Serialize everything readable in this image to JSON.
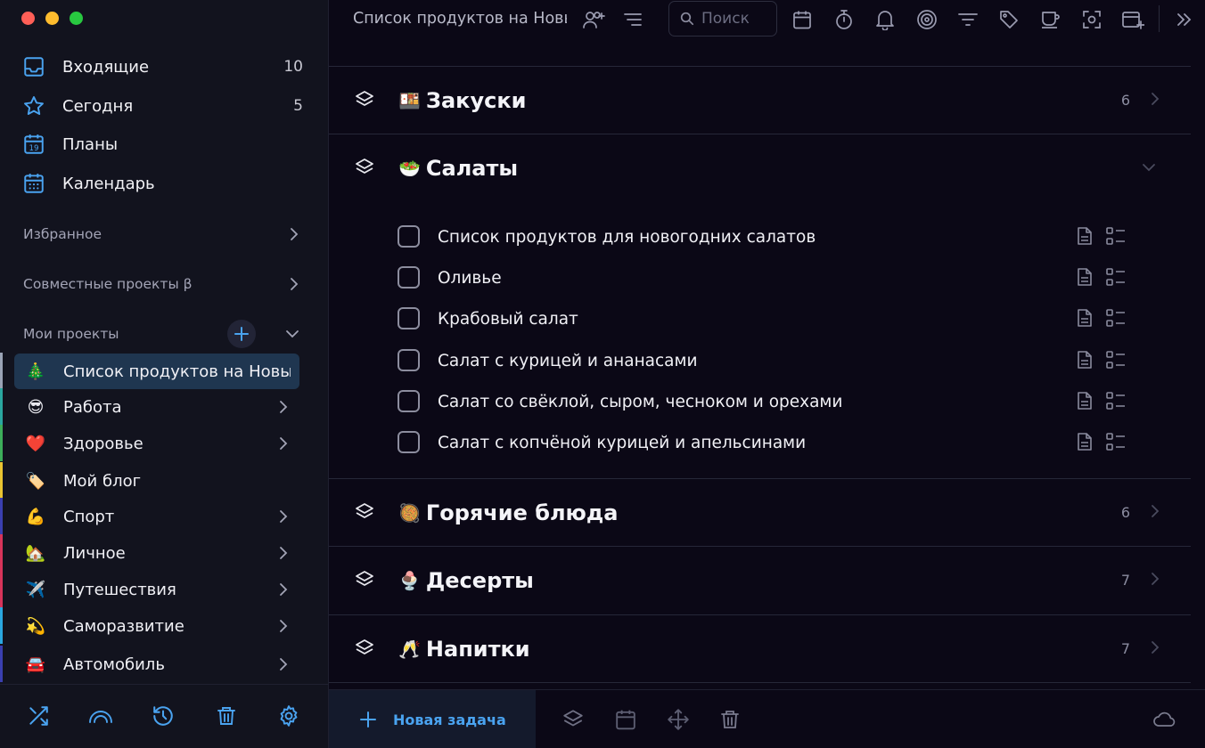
{
  "colors": {
    "accent": "#4aa3f0",
    "active_project_bg": "#1f3650"
  },
  "nav": {
    "inbox": {
      "label": "Входящие",
      "count": "10",
      "icon": "inbox-icon"
    },
    "today": {
      "label": "Сегодня",
      "count": "5",
      "icon": "star-icon"
    },
    "plans": {
      "label": "Планы",
      "icon": "calendar-19-icon"
    },
    "calendar": {
      "label": "Календарь",
      "icon": "calendar-grid-icon"
    }
  },
  "sections": {
    "favorites": "Избранное",
    "shared": "Совместные проекты β",
    "my_projects": "Мои проекты"
  },
  "projects": [
    {
      "emoji": "🎄",
      "label": "Список продуктов на Новый год",
      "color": "#9aa3b5"
    },
    {
      "emoji": "😎",
      "label": "Работа",
      "color": "#2aa7a0"
    },
    {
      "emoji": "❤️",
      "label": "Здоровье",
      "color": "#3cae5a"
    },
    {
      "emoji": "🏷️",
      "label": "Мой блог",
      "color": "#e9c431"
    },
    {
      "emoji": "💪",
      "label": "Спорт",
      "color": "#3a3fb0"
    },
    {
      "emoji": "🏡",
      "label": "Личное",
      "color": "#d7345a"
    },
    {
      "emoji": "✈️",
      "label": "Путешествия",
      "color": "#d7345a"
    },
    {
      "emoji": "💫",
      "label": "Саморазвитие",
      "color": "#2aa7e0"
    },
    {
      "emoji": "🚘",
      "label": "Автомобиль",
      "color": "#3a3fb0"
    }
  ],
  "header": {
    "title": "Список продуктов на Новый год",
    "search_placeholder": "Поиск"
  },
  "groups": [
    {
      "emoji": "🍱",
      "title": "Закуски",
      "count": "6"
    },
    {
      "emoji": "🥗",
      "title": "Салаты",
      "count": ""
    },
    {
      "emoji": "🥘",
      "title": "Горячие блюда",
      "count": "6"
    },
    {
      "emoji": "🍨",
      "title": "Десерты",
      "count": "7"
    },
    {
      "emoji": "🥂",
      "title": "Напитки",
      "count": "7"
    }
  ],
  "tasks": [
    "Список продуктов для новогодних салатов",
    "Оливье",
    "Крабовый салат",
    "Салат с курицей и ананасами",
    "Салат со свёклой, сыром, чесноком и орехами",
    "Салат с копчёной курицей и апельсинами"
  ],
  "footer": {
    "new_task": "Новая задача"
  }
}
